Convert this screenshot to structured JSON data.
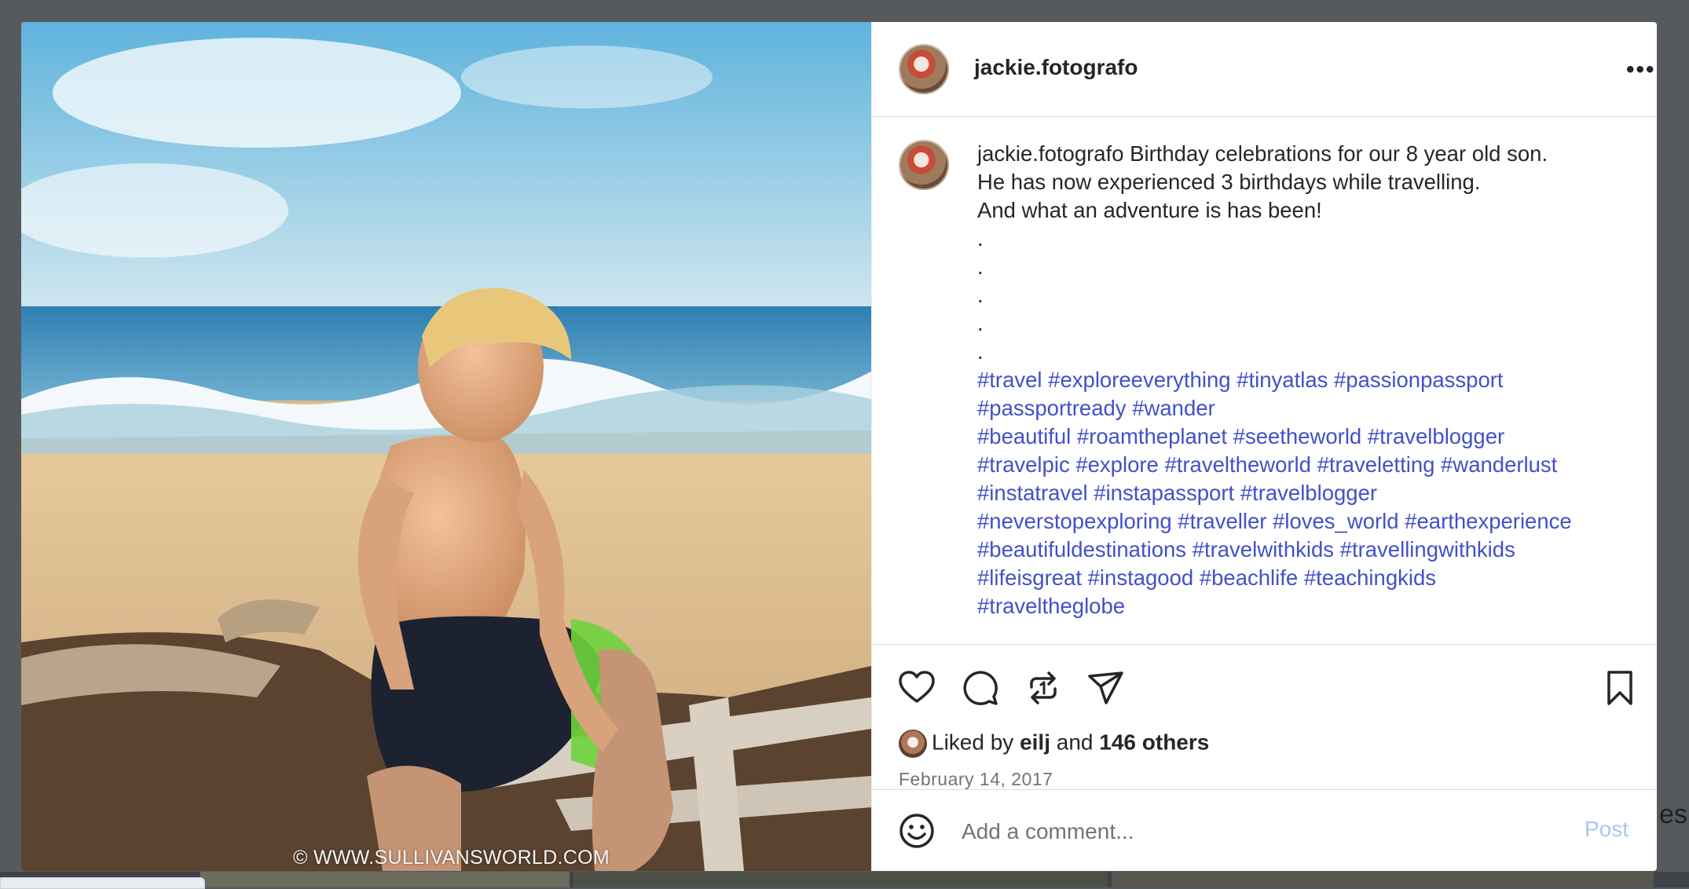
{
  "post": {
    "username": "jackie.fotografo",
    "more_label": "•••",
    "watermark": "© WWW.SULLIVANSWORLD.COM",
    "caption_user": "jackie.fotografo",
    "caption_lines": [
      "Birthday celebrations for our 8 year old son.",
      "He has now experienced 3 birthdays while travelling.",
      "And what an adventure is has been!",
      ".",
      ".",
      ".",
      ".",
      "."
    ],
    "hashtag_lines": [
      "#travel #exploreeverything #tinyatlas #passionpassport",
      "#passportready #wander",
      "#beautiful #roamtheplanet #seetheworld #travelblogger",
      "#travelpic #explore #traveltheworld #traveletting #wanderlust",
      "#instatravel #instapassport #travelblogger",
      "#neverstopexploring #traveller #loves_world #earthexperience",
      "#beautifuldestinations #travelwithkids #travellingwithkids",
      "#lifeisgreat #instagood #beachlife #teachingkids",
      "#traveltheglobe"
    ],
    "likes_prefix": "Liked by",
    "liked_by_user": "eilj",
    "likes_and": "and",
    "likes_others": "146 others",
    "date": "February 14, 2017",
    "comment_placeholder": "Add a comment...",
    "post_button": "Post"
  },
  "icons": {
    "like": "heart-icon",
    "comment": "comment-icon",
    "repost": "repost-icon",
    "share": "share-icon",
    "save": "bookmark-icon",
    "emoji": "emoji-icon"
  },
  "background": {
    "right_text": "es"
  },
  "colors": {
    "hashtag": "#4151c8",
    "post_button": "#a6c8f5",
    "overlay": "#565a5e"
  }
}
